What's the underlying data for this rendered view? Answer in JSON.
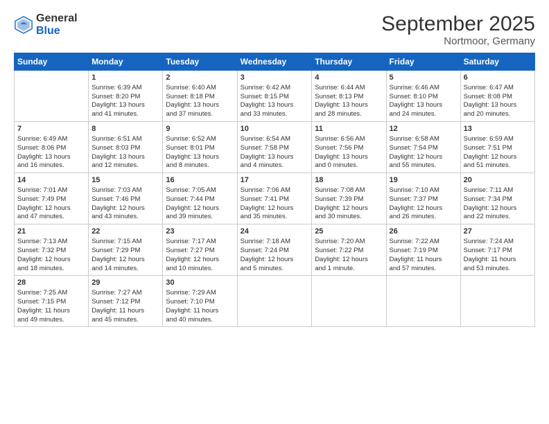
{
  "header": {
    "logo_general": "General",
    "logo_blue": "Blue",
    "month_title": "September 2025",
    "location": "Nortmoor, Germany"
  },
  "days_of_week": [
    "Sunday",
    "Monday",
    "Tuesday",
    "Wednesday",
    "Thursday",
    "Friday",
    "Saturday"
  ],
  "weeks": [
    [
      {
        "day": "",
        "content": ""
      },
      {
        "day": "1",
        "content": "Sunrise: 6:39 AM\nSunset: 8:20 PM\nDaylight: 13 hours\nand 41 minutes."
      },
      {
        "day": "2",
        "content": "Sunrise: 6:40 AM\nSunset: 8:18 PM\nDaylight: 13 hours\nand 37 minutes."
      },
      {
        "day": "3",
        "content": "Sunrise: 6:42 AM\nSunset: 8:15 PM\nDaylight: 13 hours\nand 33 minutes."
      },
      {
        "day": "4",
        "content": "Sunrise: 6:44 AM\nSunset: 8:13 PM\nDaylight: 13 hours\nand 28 minutes."
      },
      {
        "day": "5",
        "content": "Sunrise: 6:46 AM\nSunset: 8:10 PM\nDaylight: 13 hours\nand 24 minutes."
      },
      {
        "day": "6",
        "content": "Sunrise: 6:47 AM\nSunset: 8:08 PM\nDaylight: 13 hours\nand 20 minutes."
      }
    ],
    [
      {
        "day": "7",
        "content": "Sunrise: 6:49 AM\nSunset: 8:06 PM\nDaylight: 13 hours\nand 16 minutes."
      },
      {
        "day": "8",
        "content": "Sunrise: 6:51 AM\nSunset: 8:03 PM\nDaylight: 13 hours\nand 12 minutes."
      },
      {
        "day": "9",
        "content": "Sunrise: 6:52 AM\nSunset: 8:01 PM\nDaylight: 13 hours\nand 8 minutes."
      },
      {
        "day": "10",
        "content": "Sunrise: 6:54 AM\nSunset: 7:58 PM\nDaylight: 13 hours\nand 4 minutes."
      },
      {
        "day": "11",
        "content": "Sunrise: 6:56 AM\nSunset: 7:56 PM\nDaylight: 13 hours\nand 0 minutes."
      },
      {
        "day": "12",
        "content": "Sunrise: 6:58 AM\nSunset: 7:54 PM\nDaylight: 12 hours\nand 55 minutes."
      },
      {
        "day": "13",
        "content": "Sunrise: 6:59 AM\nSunset: 7:51 PM\nDaylight: 12 hours\nand 51 minutes."
      }
    ],
    [
      {
        "day": "14",
        "content": "Sunrise: 7:01 AM\nSunset: 7:49 PM\nDaylight: 12 hours\nand 47 minutes."
      },
      {
        "day": "15",
        "content": "Sunrise: 7:03 AM\nSunset: 7:46 PM\nDaylight: 12 hours\nand 43 minutes."
      },
      {
        "day": "16",
        "content": "Sunrise: 7:05 AM\nSunset: 7:44 PM\nDaylight: 12 hours\nand 39 minutes."
      },
      {
        "day": "17",
        "content": "Sunrise: 7:06 AM\nSunset: 7:41 PM\nDaylight: 12 hours\nand 35 minutes."
      },
      {
        "day": "18",
        "content": "Sunrise: 7:08 AM\nSunset: 7:39 PM\nDaylight: 12 hours\nand 30 minutes."
      },
      {
        "day": "19",
        "content": "Sunrise: 7:10 AM\nSunset: 7:37 PM\nDaylight: 12 hours\nand 26 minutes."
      },
      {
        "day": "20",
        "content": "Sunrise: 7:11 AM\nSunset: 7:34 PM\nDaylight: 12 hours\nand 22 minutes."
      }
    ],
    [
      {
        "day": "21",
        "content": "Sunrise: 7:13 AM\nSunset: 7:32 PM\nDaylight: 12 hours\nand 18 minutes."
      },
      {
        "day": "22",
        "content": "Sunrise: 7:15 AM\nSunset: 7:29 PM\nDaylight: 12 hours\nand 14 minutes."
      },
      {
        "day": "23",
        "content": "Sunrise: 7:17 AM\nSunset: 7:27 PM\nDaylight: 12 hours\nand 10 minutes."
      },
      {
        "day": "24",
        "content": "Sunrise: 7:18 AM\nSunset: 7:24 PM\nDaylight: 12 hours\nand 5 minutes."
      },
      {
        "day": "25",
        "content": "Sunrise: 7:20 AM\nSunset: 7:22 PM\nDaylight: 12 hours\nand 1 minute."
      },
      {
        "day": "26",
        "content": "Sunrise: 7:22 AM\nSunset: 7:19 PM\nDaylight: 11 hours\nand 57 minutes."
      },
      {
        "day": "27",
        "content": "Sunrise: 7:24 AM\nSunset: 7:17 PM\nDaylight: 11 hours\nand 53 minutes."
      }
    ],
    [
      {
        "day": "28",
        "content": "Sunrise: 7:25 AM\nSunset: 7:15 PM\nDaylight: 11 hours\nand 49 minutes."
      },
      {
        "day": "29",
        "content": "Sunrise: 7:27 AM\nSunset: 7:12 PM\nDaylight: 11 hours\nand 45 minutes."
      },
      {
        "day": "30",
        "content": "Sunrise: 7:29 AM\nSunset: 7:10 PM\nDaylight: 11 hours\nand 40 minutes."
      },
      {
        "day": "",
        "content": ""
      },
      {
        "day": "",
        "content": ""
      },
      {
        "day": "",
        "content": ""
      },
      {
        "day": "",
        "content": ""
      }
    ]
  ]
}
